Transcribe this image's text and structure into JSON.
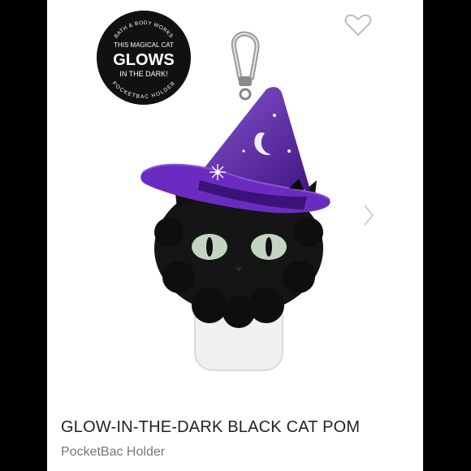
{
  "badge": {
    "brand": "BATH & BODY WORKS",
    "line1": "THIS MAGICAL CAT",
    "line2": "GLOWS",
    "line3": "IN THE DARK!",
    "bottom": "POCKETBAC HOLDER"
  },
  "product": {
    "title": "GLOW-IN-THE-DARK BLACK CAT POM",
    "subtitle": "PocketBac Holder"
  },
  "icons": {
    "favorite": "heart-outline-icon",
    "next": "chevron-right-icon"
  }
}
